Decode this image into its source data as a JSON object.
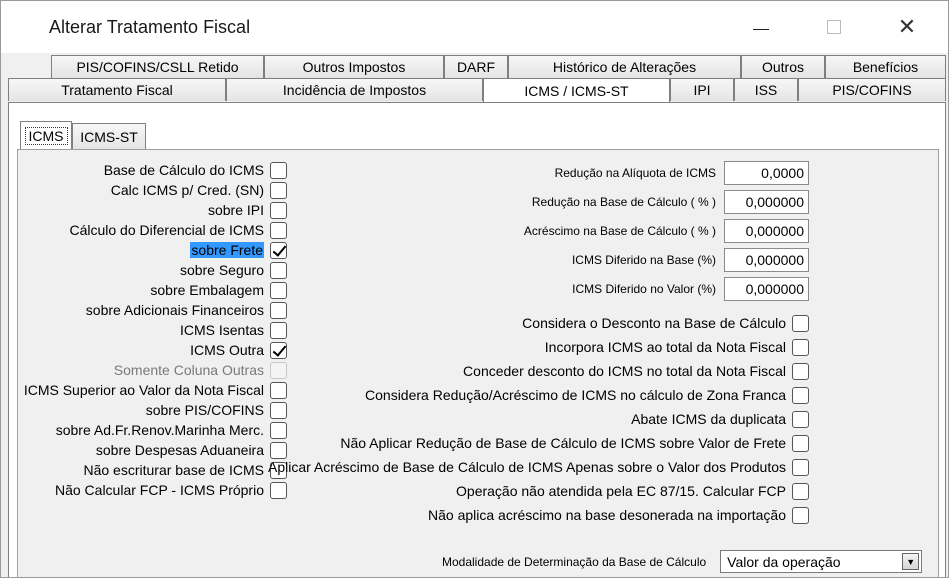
{
  "window": {
    "title": "Alterar Tratamento Fiscal",
    "minimize_glyph": "—",
    "close_glyph": "✕"
  },
  "tabs_row1": [
    "PIS/COFINS/CSLL Retido",
    "Outros Impostos",
    "DARF",
    "Histórico de Alterações",
    "Outros",
    "Benefícios"
  ],
  "tabs_row2": [
    "Tratamento Fiscal",
    "Incidência de Impostos",
    "ICMS / ICMS-ST",
    "IPI",
    "ISS",
    "PIS/COFINS"
  ],
  "active_tab": "ICMS / ICMS-ST",
  "subtabs": [
    "ICMS",
    "ICMS-ST"
  ],
  "active_subtab": "ICMS",
  "left_options": [
    {
      "label": "Base de Cálculo do ICMS",
      "checked": false
    },
    {
      "label": "Calc ICMS p/ Cred. (SN)",
      "checked": false
    },
    {
      "label": "sobre IPI",
      "checked": false
    },
    {
      "label": "Cálculo do Diferencial de ICMS",
      "checked": false
    },
    {
      "label": "sobre Frete",
      "checked": true,
      "selected": true
    },
    {
      "label": "sobre Seguro",
      "checked": false
    },
    {
      "label": "sobre Embalagem",
      "checked": false
    },
    {
      "label": "sobre Adicionais Financeiros",
      "checked": false
    },
    {
      "label": "ICMS Isentas",
      "checked": false
    },
    {
      "label": "ICMS Outra",
      "checked": true
    },
    {
      "label": "Somente Coluna Outras",
      "checked": false,
      "disabled": true
    },
    {
      "label": "ICMS Superior ao Valor da Nota Fiscal",
      "checked": false
    },
    {
      "label": "sobre PIS/COFINS",
      "checked": false
    },
    {
      "label": "sobre Ad.Fr.Renov.Marinha Merc.",
      "checked": false
    },
    {
      "label": "sobre Despesas Aduaneira",
      "checked": false
    },
    {
      "label": "Não escriturar base de ICMS",
      "checked": false
    },
    {
      "label": "Não Calcular FCP - ICMS Próprio",
      "checked": false
    }
  ],
  "numeric_fields": [
    {
      "label": "Redução na Alíquota de ICMS",
      "value": "0,0000"
    },
    {
      "label": "Redução na Base de Cálculo ( % )",
      "value": "0,000000"
    },
    {
      "label": "Acréscimo na Base de Cálculo ( % )",
      "value": "0,000000"
    },
    {
      "label": "ICMS Diferido na Base (%)",
      "value": "0,000000"
    },
    {
      "label": "ICMS Diferido no Valor (%)",
      "value": "0,000000"
    }
  ],
  "right_options": [
    {
      "label": "Considera o Desconto na Base de Cálculo",
      "checked": false
    },
    {
      "label": "Incorpora ICMS ao total da Nota Fiscal",
      "checked": false
    },
    {
      "label": "Conceder desconto do ICMS no total da Nota Fiscal",
      "checked": false
    },
    {
      "label": "Considera Redução/Acréscimo de ICMS no cálculo de Zona Franca",
      "checked": false
    },
    {
      "label": "Abate ICMS da duplicata",
      "checked": false
    },
    {
      "label": "Não Aplicar Redução de Base de Cálculo de ICMS sobre Valor de Frete",
      "checked": false
    },
    {
      "label": "Aplicar Acréscimo de Base de Cálculo de ICMS Apenas sobre o Valor dos Produtos",
      "checked": false
    },
    {
      "label": "Operação não atendida pela EC 87/15. Calcular FCP",
      "checked": false
    },
    {
      "label": "Não aplica acréscimo na base desonerada na importação",
      "checked": false
    }
  ],
  "modalidade": {
    "label": "Modalidade de Determinação da Base de Cálculo",
    "value": "Valor da operação",
    "arrow_glyph": "▼"
  }
}
